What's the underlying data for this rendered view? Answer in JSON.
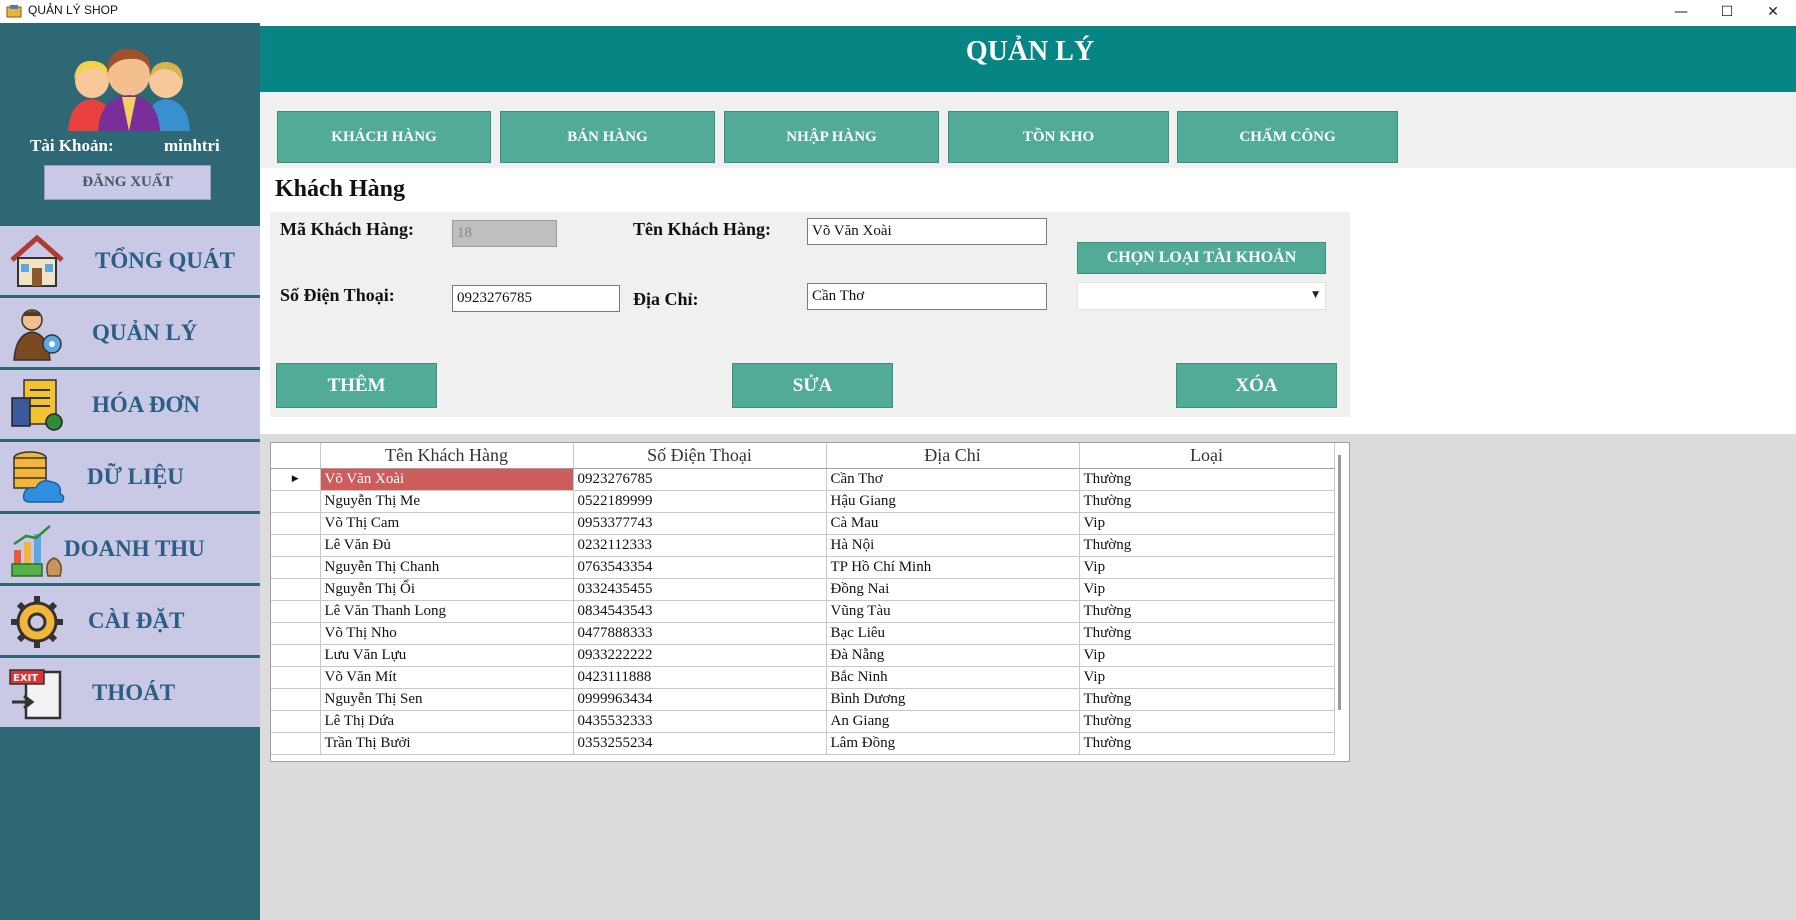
{
  "window": {
    "title": "QUẢN LÝ SHOP",
    "minimize_glyph": "—",
    "maximize_glyph": "☐",
    "close_glyph": "✕"
  },
  "sidebar": {
    "account_label": "Tài Khoản:",
    "account_name": "minhtri",
    "logout_label": "ĐĂNG XUẤT",
    "items": [
      {
        "label": "TỔNG QUÁT",
        "icon": "house-icon"
      },
      {
        "label": "QUẢN LÝ",
        "icon": "manager-icon"
      },
      {
        "label": "HÓA ĐƠN",
        "icon": "invoice-icon"
      },
      {
        "label": "DỮ LIỆU",
        "icon": "database-cloud-icon"
      },
      {
        "label": "DOANH THU",
        "icon": "revenue-chart-icon"
      },
      {
        "label": "CÀI ĐẶT",
        "icon": "gear-icon"
      },
      {
        "label": "THOÁT",
        "icon": "exit-icon"
      }
    ]
  },
  "header": {
    "title": "QUẢN LÝ"
  },
  "tabs": [
    "KHÁCH HÀNG",
    "BÁN HÀNG",
    "NHẬP HÀNG",
    "TỒN KHO",
    "CHẤM CÔNG"
  ],
  "section_title": "Khách Hàng",
  "form": {
    "id_label": "Mã Khách Hàng:",
    "id_value": "18",
    "name_label": "Tên Khách Hàng:",
    "name_value": "Võ Văn Xoài",
    "phone_label": "Số Điện Thoại:",
    "phone_value": "0923276785",
    "address_label": "Địa Chỉ:",
    "address_value": "Cần Thơ",
    "account_type_button": "CHỌN LOẠI TÀI KHOẢN",
    "account_type_value": "",
    "add_button": "THÊM",
    "edit_button": "SỬA",
    "delete_button": "XÓA"
  },
  "grid": {
    "columns": [
      "Tên Khách Hàng",
      "Số Điện Thoại",
      "Địa Chỉ",
      "Loại"
    ],
    "selected_marker": "▶",
    "rows": [
      [
        "Võ Văn Xoài",
        "0923276785",
        "Cần Thơ",
        "Thường"
      ],
      [
        "Nguyễn Thị Me",
        "0522189999",
        "Hậu Giang",
        "Thường"
      ],
      [
        "Võ Thị Cam",
        "0953377743",
        "Cà Mau",
        "Vip"
      ],
      [
        "Lê Văn Đủ",
        "0232112333",
        "Hà Nội",
        "Thường"
      ],
      [
        "Nguyễn Thị Chanh",
        "0763543354",
        "TP Hồ Chí Minh",
        "Vip"
      ],
      [
        "Nguyễn Thị Ổi",
        "0332435455",
        "Đồng Nai",
        "Vip"
      ],
      [
        "Lê Văn Thanh Long",
        "0834543543",
        "Vũng Tàu",
        "Thường"
      ],
      [
        "Võ Thị Nho",
        "0477888333",
        "Bạc Liêu",
        "Thường"
      ],
      [
        "Lưu Văn Lựu",
        "0933222222",
        "Đà Nẵng",
        "Vip"
      ],
      [
        "Võ Văn Mít",
        "0423111888",
        "Bắc Ninh",
        "Vip"
      ],
      [
        "Nguyễn Thị Sen",
        "0999963434",
        "Bình Dương",
        "Thường"
      ],
      [
        "Lê Thị Dứa",
        "0435532333",
        "An Giang",
        "Thường"
      ],
      [
        "Trần Thị Bưởi",
        "0353255234",
        "Lâm Đồng",
        "Thường"
      ]
    ]
  },
  "colors": {
    "sidebar_bg": "#2d6874",
    "menu_bg": "#c9c9e6",
    "header_bg": "#078484",
    "button_bg": "#52ab97",
    "selected_row": "#cd5c5c"
  }
}
